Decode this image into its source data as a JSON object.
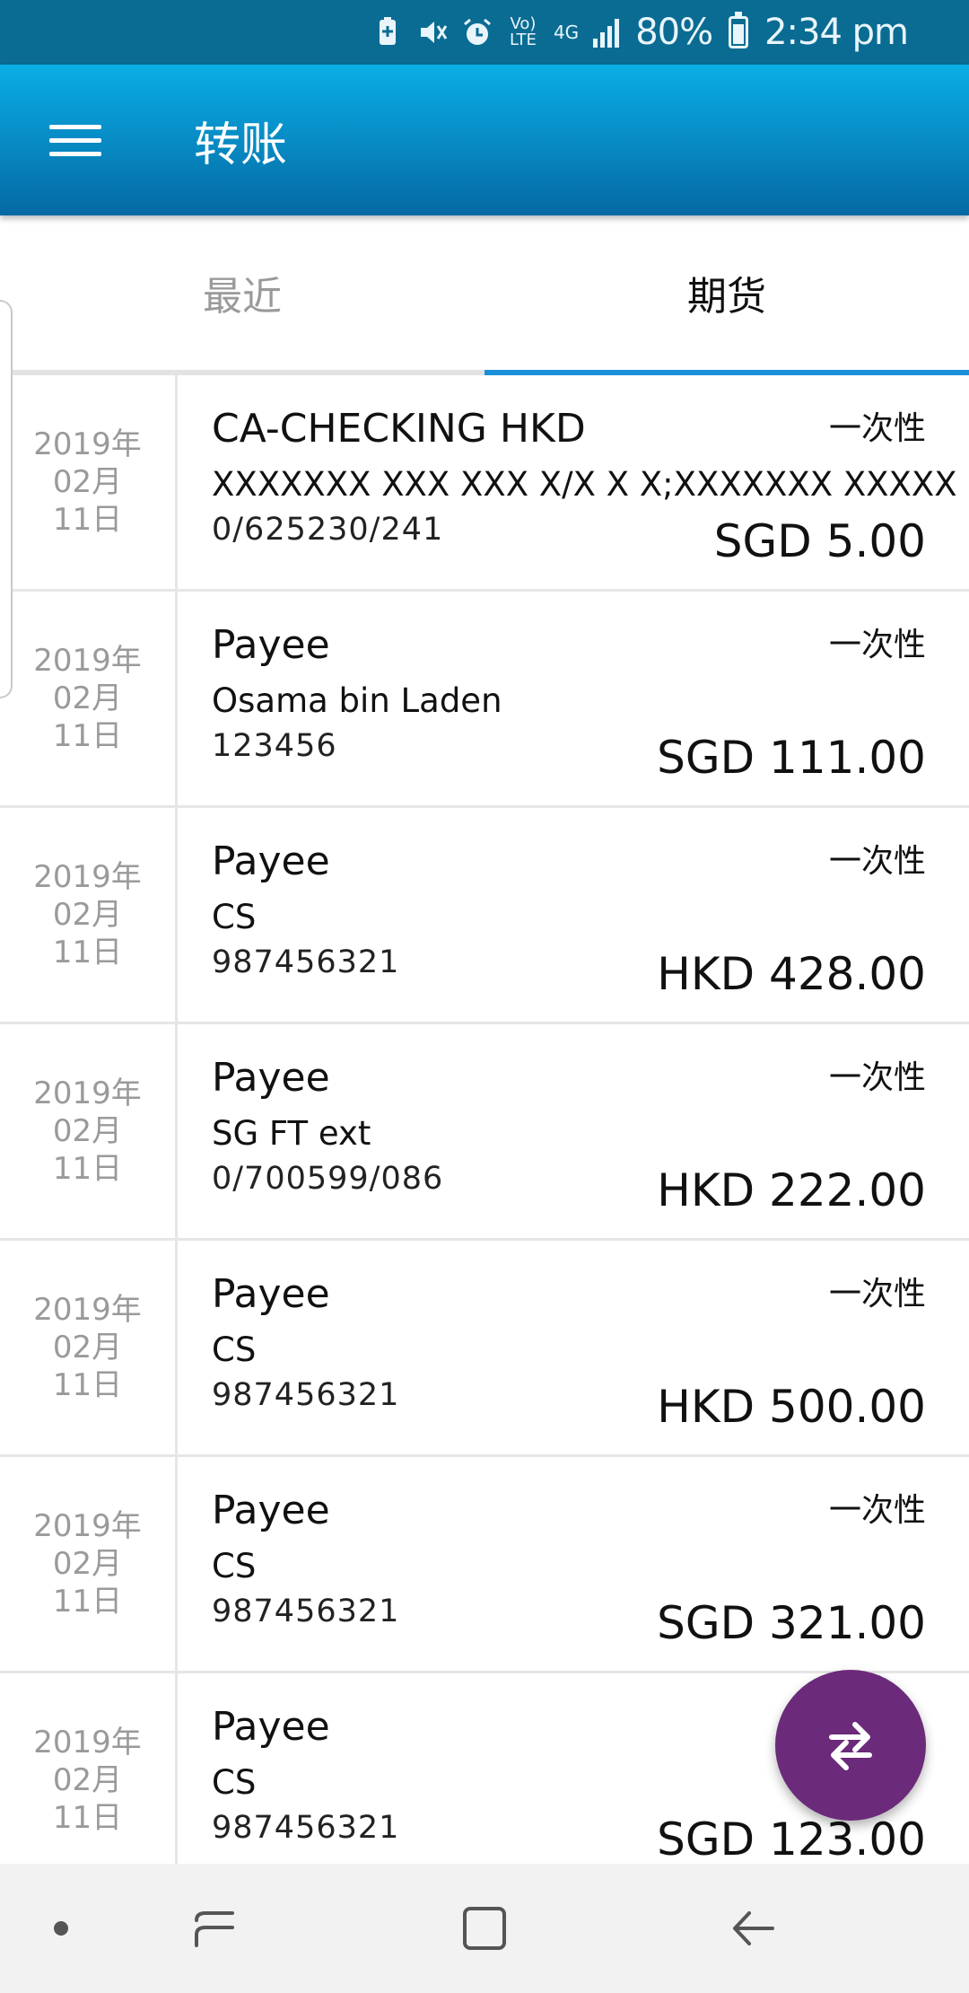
{
  "status_bar": {
    "battery_percent": "80%",
    "time": "2:34 pm",
    "network_label": "4G",
    "volte_label": "Vo) LTE"
  },
  "app_bar": {
    "title": "转账",
    "menu_icon": "hamburger-menu-icon"
  },
  "tabs": [
    {
      "label": "最近",
      "active": false
    },
    {
      "label": "期货",
      "active": true
    }
  ],
  "transfers": [
    {
      "date": [
        "2019年",
        "02月",
        "11日"
      ],
      "title": "CA-CHECKING HKD",
      "name": "XXXXXXX XXX XXX X/X X X;XXXXXXX XXXXX",
      "account": "0/625230/241",
      "frequency": "一次性",
      "amount": "SGD 5.00"
    },
    {
      "date": [
        "2019年",
        "02月",
        "11日"
      ],
      "title": "Payee",
      "name": "Osama bin Laden",
      "account": "123456",
      "frequency": "一次性",
      "amount": "SGD 111.00"
    },
    {
      "date": [
        "2019年",
        "02月",
        "11日"
      ],
      "title": "Payee",
      "name": "CS",
      "account": "987456321",
      "frequency": "一次性",
      "amount": "HKD 428.00"
    },
    {
      "date": [
        "2019年",
        "02月",
        "11日"
      ],
      "title": "Payee",
      "name": "SG FT ext",
      "account": "0/700599/086",
      "frequency": "一次性",
      "amount": "HKD 222.00"
    },
    {
      "date": [
        "2019年",
        "02月",
        "11日"
      ],
      "title": "Payee",
      "name": "CS",
      "account": "987456321",
      "frequency": "一次性",
      "amount": "HKD 500.00"
    },
    {
      "date": [
        "2019年",
        "02月",
        "11日"
      ],
      "title": "Payee",
      "name": "CS",
      "account": "987456321",
      "frequency": "一次性",
      "amount": "SGD 321.00"
    },
    {
      "date": [
        "2019年",
        "02月",
        "11日"
      ],
      "title": "Payee",
      "name": "CS",
      "account": "987456321",
      "frequency": "",
      "amount": "SGD 123.00"
    }
  ],
  "fab": {
    "icon": "transfer-arrows-icon",
    "color": "#6b2a7a"
  },
  "nav_bar": {
    "items": [
      "dot-icon",
      "recents-icon",
      "home-icon",
      "back-icon"
    ]
  },
  "colors": {
    "status_bar": "#0a6c93",
    "app_bar_top": "#0aaee6",
    "app_bar_bottom": "#0569a3",
    "tab_indicator": "#1c8fdb"
  }
}
